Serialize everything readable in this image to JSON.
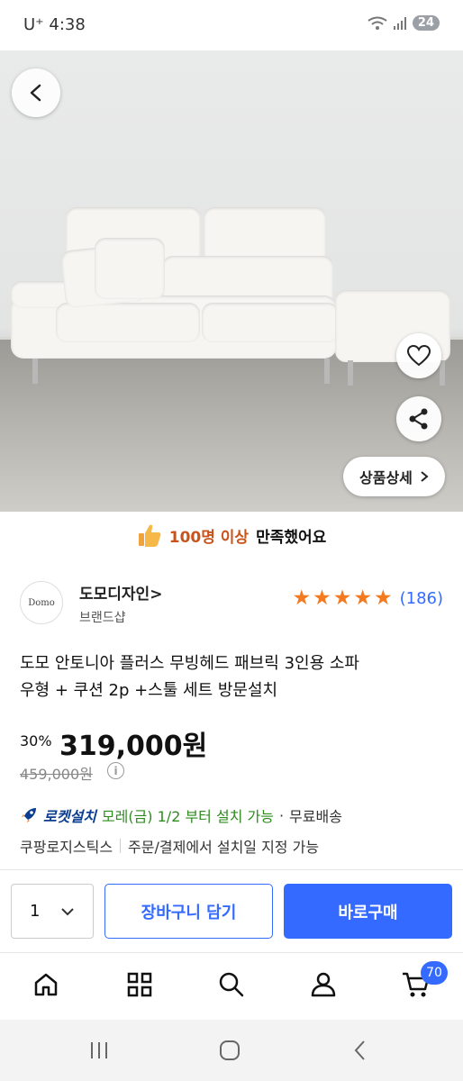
{
  "status_bar": {
    "carrier_time": "U⁺ 4:38",
    "battery": "24"
  },
  "hero": {
    "detail_label": "상품상세",
    "dots_total": 10,
    "dots_active_index": 0
  },
  "satisfaction": {
    "highlight": "100명 이상",
    "rest": "만족했어요"
  },
  "brand": {
    "logo_text": "Domo",
    "name": "도모디자인>",
    "sub": "브랜드샵",
    "rating_stars": 5,
    "rating_count": "(186)"
  },
  "product": {
    "title_line1": "도모 안토니아 플러스 무빙헤드 패브릭 3인용 소파",
    "title_line2": "우형 + 쿠션 2p +스툴 세트 방문설치",
    "discount": "30%",
    "price": "319,000원",
    "original_price": "459,000원"
  },
  "delivery": {
    "rocket_label": "로켓설치",
    "date_text": "모레(금) 1/2 부터 설치 가능",
    "dot": "·",
    "free_shipping": "무료배송",
    "logistics": "쿠팡로지스틱스",
    "logistics_note": "주문/결제에서 설치일 지정 가능"
  },
  "actions": {
    "quantity": "1",
    "cart_label": "장바구니 담기",
    "buy_label": "바로구매"
  },
  "bottom_nav": {
    "cart_count": "70",
    "icons": [
      "home-icon",
      "grid-icon",
      "search-icon",
      "user-icon",
      "cart-icon"
    ]
  },
  "colors": {
    "accent": "#346aff",
    "star": "#f47a1f",
    "delivery_green": "#2f8a20",
    "highlight_orange": "#c9541b"
  }
}
